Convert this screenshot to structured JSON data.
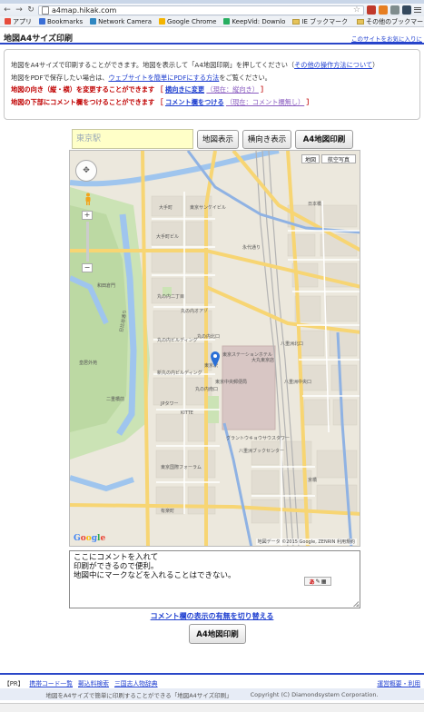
{
  "browser": {
    "url": "a4map.hikak.com",
    "bookmarks": [
      {
        "label": "アプリ",
        "color": "#e74c3c"
      },
      {
        "label": "Bookmarks",
        "color": "#3b6fd6"
      },
      {
        "label": "Network Camera",
        "color": "#2e86c1"
      },
      {
        "label": "Google Chrome",
        "color": "#f4b400"
      },
      {
        "label": "KeepVid: Downlo",
        "color": "#27ae60"
      },
      {
        "label": "IE ブックマーク",
        "color": "#e6c35a"
      }
    ],
    "other_bookmarks": "その他のブックマー"
  },
  "header": {
    "title": "地図A4サイズ印刷",
    "other_sites": "このサイトをお気に入りに"
  },
  "info": {
    "line1_text": "地図をA4サイズで印刷することができます。地図を表示して「A4地図印刷」を押してください（",
    "line1_link": "その他の操作方法について",
    "line1_end": "）",
    "line2_text": "地図をPDFで保存したい場合は、",
    "line2_link": "ウェブサイトを簡単にPDFにする方法",
    "line2_end": "をご覧ください。",
    "line3_label": "地図の向き（縦・横）を変更することができます",
    "line3_open": "［",
    "line3_link": "横向きに変更",
    "line3_state": "（現在：縦向き）",
    "line3_close": "］",
    "line4_label": "地図の下部にコメント欄をつけることができます",
    "line4_open": "［",
    "line4_link": "コメント欄をつける",
    "line4_state": "（現在：コメント欄無し）",
    "line4_close": "］"
  },
  "controls": {
    "address_placeholder": "東京駅",
    "show_map": "地図表示",
    "landscape": "横向き表示",
    "print": "A4地図印刷"
  },
  "map": {
    "type_map": "地図",
    "type_satellite": "航空写真",
    "labels": [
      "大手町",
      "東京サンケイビル",
      "大手町ビル",
      "日比谷通り",
      "永代通り",
      "丸の内オアゾ",
      "丸の内ビルディング",
      "丸の内北口",
      "新丸の内ビルディング",
      "東京駅",
      "大丸東京店",
      "八重洲北口",
      "八重洲中央口",
      "KITTE",
      "丸の内南口",
      "JPタワー",
      "二重橋前",
      "皇居外苑",
      "東京国際フォーラム",
      "グラントウキョウサウスタワー",
      "八重洲ブックセンター",
      "京橋",
      "和田倉門",
      "日本橋",
      "東京中央郵便局",
      "有楽町",
      "丸の内二丁目",
      "東京ステーションホテル"
    ],
    "copyright": "地図データ ©2015 Google, ZENRIN",
    "terms": "利用規約",
    "logo": "Google"
  },
  "comment": {
    "text": "ここにコメントを入れて\n印刷ができるので便利。\n地図中にマークなどを入れることはできない。",
    "toggle": "コメント欄の表示の有無を切り替える"
  },
  "print_button": "A4地図印刷",
  "footer": {
    "pr": "【PR】",
    "links": [
      "携帯コード一覧",
      "郵込料検索",
      "三国志人物辞典"
    ],
    "right_link": "運営概要・利用",
    "tagline": "地図をA4サイズで簡単に印刷することができる「地図A4サイズ印刷」",
    "copyright": "Copyright (C) Diamondsystem Corporation."
  },
  "colors": {
    "accent": "#2a47c8",
    "link": "#2040d0",
    "warning": "#c00000",
    "input_bg": "#ffffc8"
  }
}
